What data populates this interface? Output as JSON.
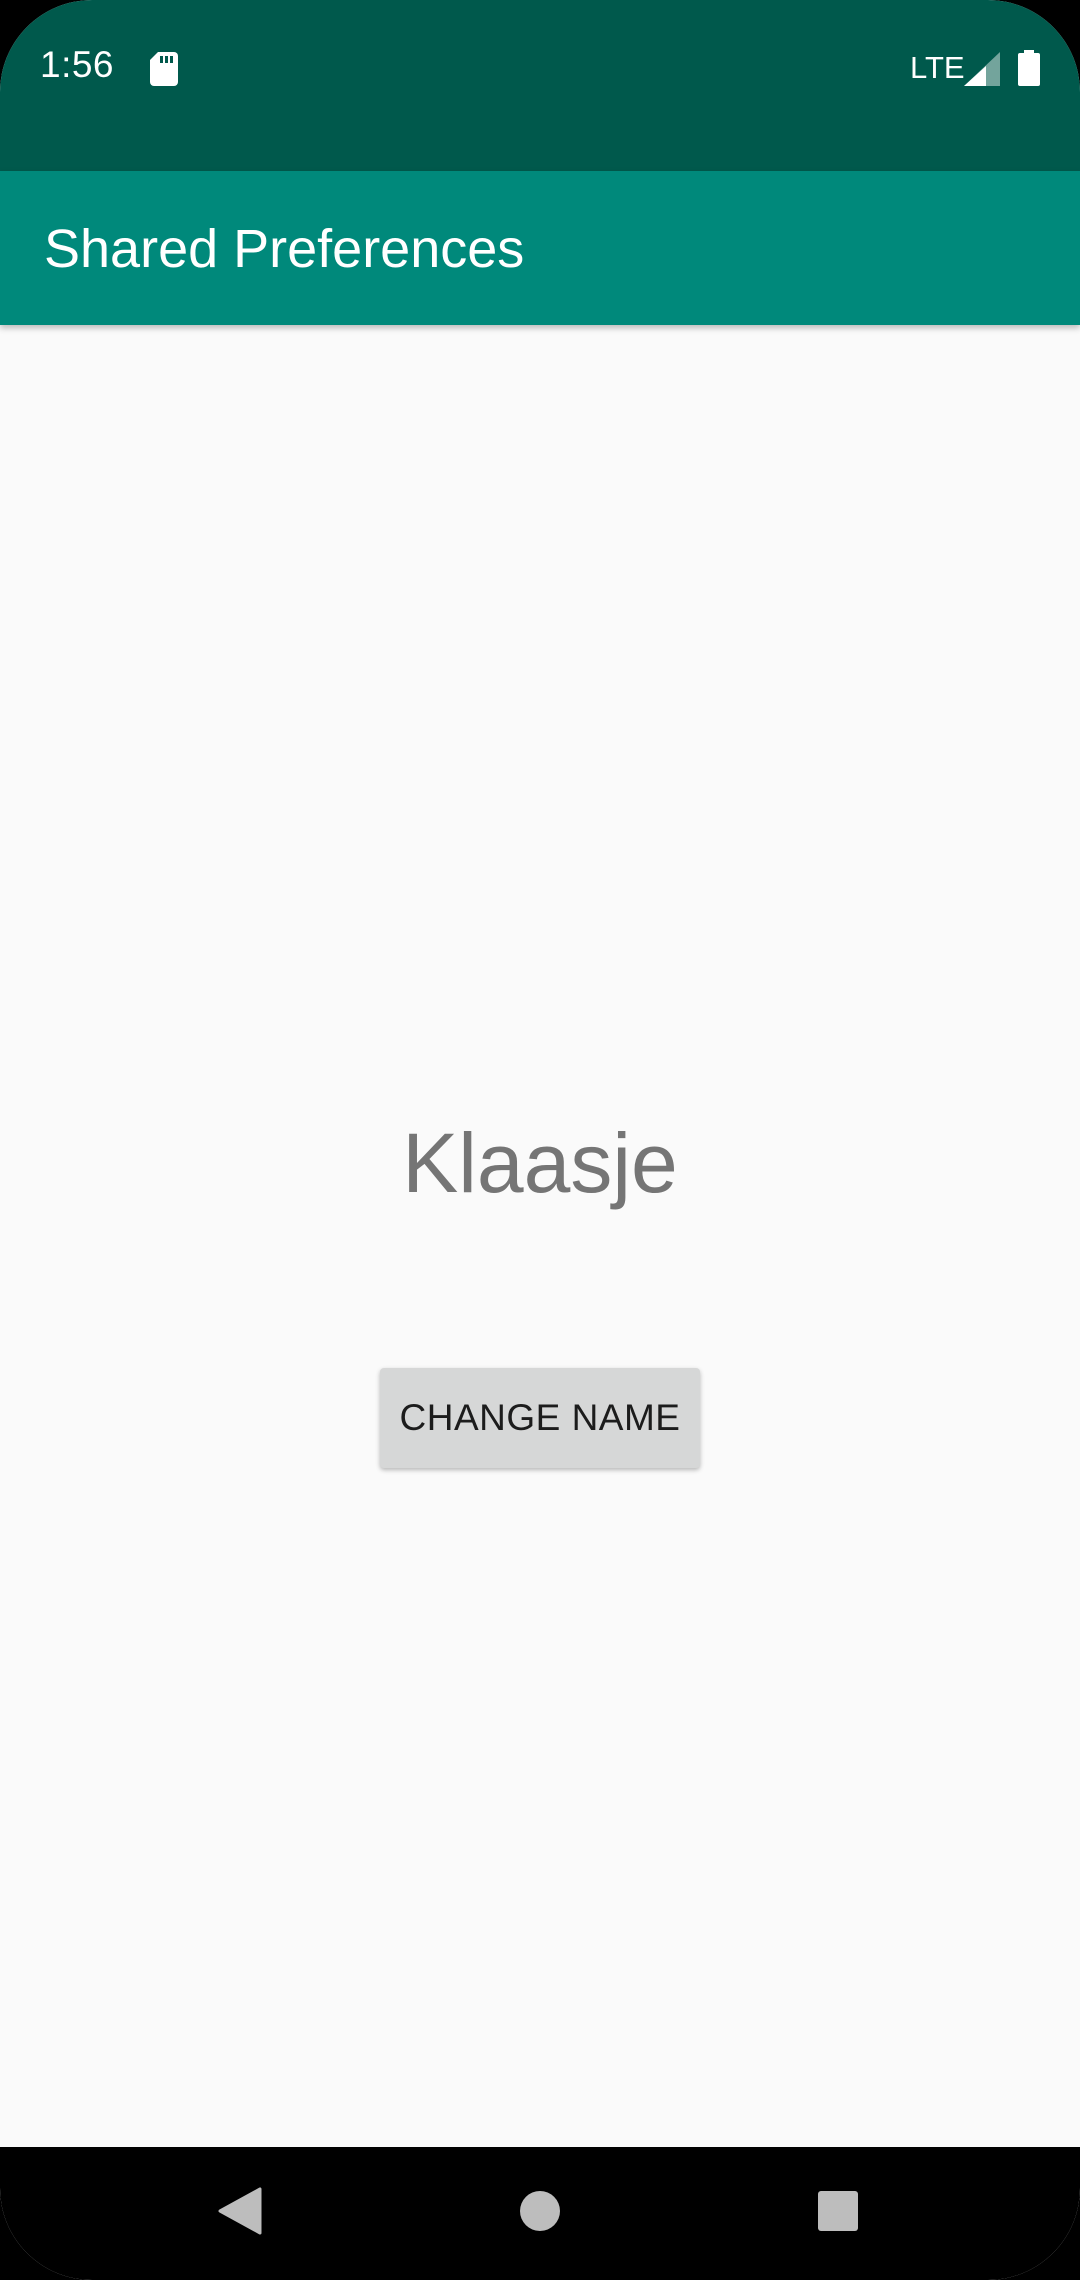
{
  "status_bar": {
    "time": "1:56",
    "network": "LTE",
    "sd_card_icon": "sd-card-icon",
    "signal_icon": "cell-signal-icon",
    "battery_icon": "battery-icon",
    "background_color": "#00594c"
  },
  "app_bar": {
    "title": "Shared Preferences",
    "background_color": "#00897b"
  },
  "main": {
    "name_text": "Klaasje",
    "change_name_button": "CHANGE NAME"
  },
  "nav_bar": {
    "back_icon": "back-triangle-icon",
    "home_icon": "home-circle-icon",
    "recents_icon": "recents-square-icon"
  }
}
